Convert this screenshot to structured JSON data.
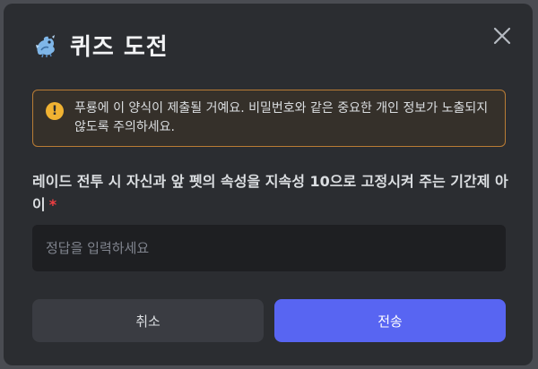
{
  "modal": {
    "title": "퀴즈 도전",
    "title_icon": "blue-dragon-icon",
    "close_icon": "close-icon"
  },
  "warning": {
    "icon": "exclamation-icon",
    "text": "푸룡에 이 양식이 제출될 거예요. 비밀번호와 같은 중요한 개인 정보가 노출되지 않도록 주의하세요."
  },
  "question": {
    "label": "레이드 전투 시 자신과 앞 펫의 속성을 지속성 10으로 고정시켜 주는 기간제 아이",
    "required_mark": "*"
  },
  "answer": {
    "value": "",
    "placeholder": "정답을 입력하세요"
  },
  "buttons": {
    "cancel_label": "취소",
    "submit_label": "전송"
  },
  "colors": {
    "modal_bg": "#2b2d31",
    "accent": "#5865f2",
    "warning_border": "#b97c35",
    "warning_icon": "#f0b232",
    "required": "#f23f43"
  }
}
